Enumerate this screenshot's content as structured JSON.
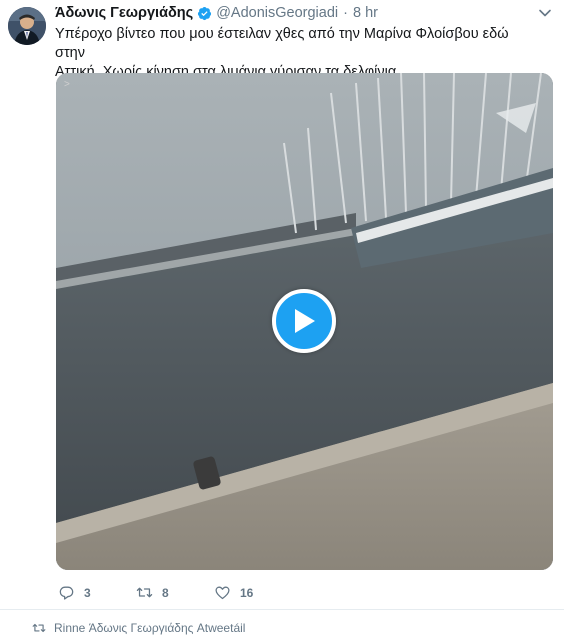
{
  "author": {
    "display_name": "Άδωνις Γεωργιάδης",
    "handle": "@AdonisGeorgiadi",
    "avatar_icon": "avatar-photo",
    "verified_icon": "verified-badge-icon"
  },
  "tweet": {
    "separator": "·",
    "time": "8 hr",
    "text_line1": "Υπέροχο βίντεο που μου έστειλαν χθες από την Μαρίνα Φλοίσβου εδώ στην",
    "text_line2": "Αττική. Χωρίς κίνηση στα λιμάνια γύρισαν τα δελφίνια..."
  },
  "media": {
    "type": "video",
    "play_icon": "play-icon"
  },
  "actions": {
    "reply_count": "3",
    "retweet_count": "8",
    "like_count": "16"
  },
  "retweet_note": {
    "text": "Rinne Άδωνις Γεωργιάδης Atweetáil"
  },
  "colors": {
    "brand_blue": "#1da1f2",
    "secondary_text": "#657786",
    "primary_text": "#14171a",
    "divider": "#e6ecf0"
  }
}
